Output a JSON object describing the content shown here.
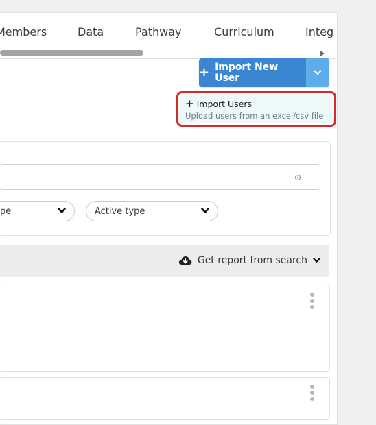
{
  "tabs": {
    "items": [
      {
        "label": "Members"
      },
      {
        "label": "Data"
      },
      {
        "label": "Pathway"
      },
      {
        "label": "Curriculum"
      },
      {
        "label": "Integ"
      }
    ]
  },
  "import_button": {
    "label": "Import New User"
  },
  "dropdown": {
    "title": "Import Users",
    "subtitle": "Upload users from an excel/csv file"
  },
  "filters": {
    "search_value": "",
    "select_1": "pe",
    "select_2": "Active type"
  },
  "report": {
    "label": "Get report from search"
  },
  "colors": {
    "primary": "#3a86d3",
    "primary_light": "#5dadeb",
    "highlight_border": "#d42a2a",
    "dropdown_bg": "#eef9f9"
  }
}
